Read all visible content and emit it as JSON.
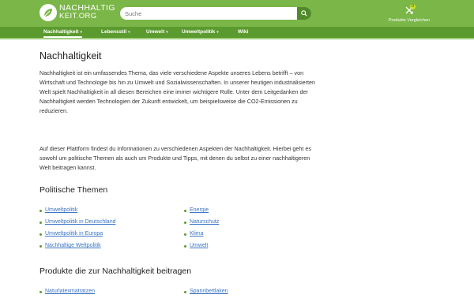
{
  "header": {
    "logo_line1": "NACHHALTIG",
    "logo_line2": "KEIT.ORG",
    "search_placeholder": "Suche",
    "compare_count": "0",
    "compare_label": "Produkte Vergleichen"
  },
  "nav": {
    "items": [
      {
        "label": "Nachhaltigkeit",
        "has_dropdown": true,
        "active": true
      },
      {
        "label": "Lebensstil",
        "has_dropdown": true,
        "active": false
      },
      {
        "label": "Umwelt",
        "has_dropdown": true,
        "active": false
      },
      {
        "label": "Umweltpolitik",
        "has_dropdown": true,
        "active": false
      },
      {
        "label": "Wiki",
        "has_dropdown": false,
        "active": false
      }
    ]
  },
  "main": {
    "title": "Nachhaltigkeit",
    "paragraph1": "Nachhaltigkeit ist ein umfassendes Thema, das viele verschiedene Aspekte unseres Lebens betrifft – von Wirtschaft und Technologie bis hin zu Umwelt und Sozialwissenschaften. In unserer heutigen industrialisierten Welt spielt Nachhaltigkeit in all diesen Bereichen eine immer wichtigere Rolle. Unter dem Leitgedanken der Nachhaltigkeit werden Technologien der Zukunft entwickelt, um beispielsweise die CO2-Emissionen zu reduzieren.",
    "paragraph2": "Auf dieser Plattform findest du Informationen zu verschiedenen Aspekten der Nachhaltigkeit. Hierbei geht es sowohl um politische Themen als auch um Produkte und Tipps, mit denen du selbst zu einer nachhaltigeren Welt beitragen kannst.",
    "section1": {
      "heading": "Politische Themen",
      "left": [
        "Umweltpolitik",
        "Umweltpolitik in Deutschland",
        "Umweltpolitik in Europa",
        "Nachhaltige Weltpolitik"
      ],
      "right": [
        "Energie",
        "Naturschutz",
        "Klima",
        "Umwelt"
      ]
    },
    "section2": {
      "heading": "Produkte die zur Nachhaltigkeit beitragen",
      "left": [
        "Naturlatexmatratzen"
      ],
      "right": [
        "Spannbettlaken"
      ]
    }
  },
  "colors": {
    "brand_green": "#7ab648",
    "nav_green": "#5b9a2f",
    "link_blue": "#3b75c6",
    "badge_yellow": "#c6e02c"
  }
}
